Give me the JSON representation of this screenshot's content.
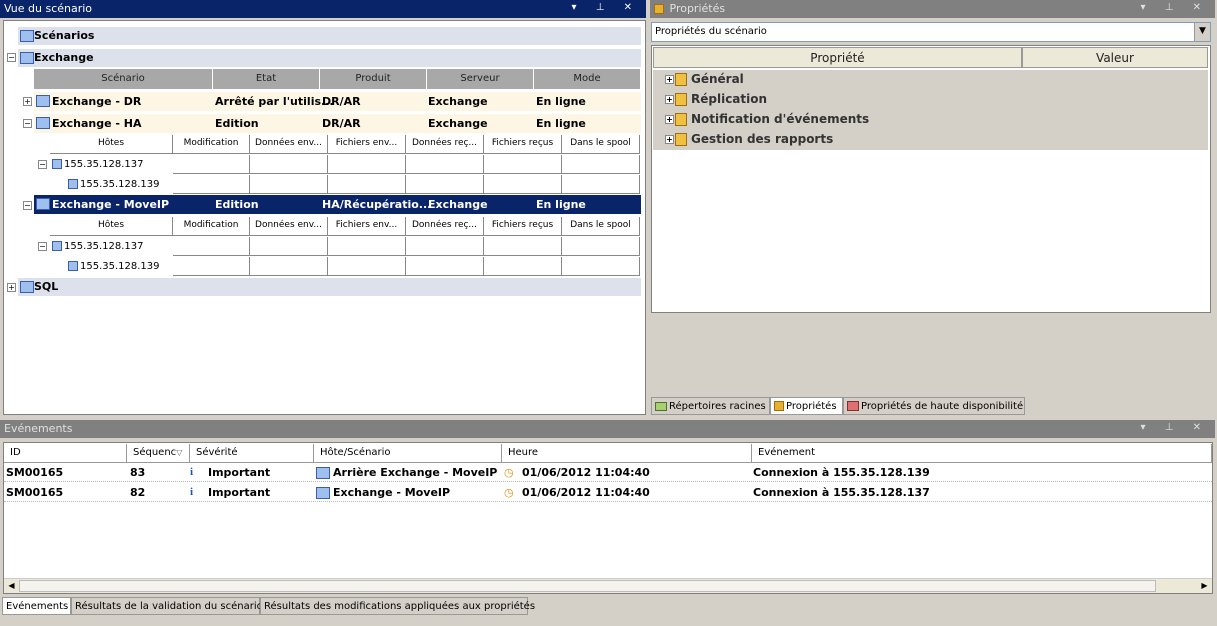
{
  "scenario_view": {
    "title": "Vue du scénario",
    "root": "Scénarios",
    "groups": [
      "Exchange",
      "SQL"
    ],
    "columns": [
      "Scénario",
      "Etat",
      "Produit",
      "Serveur",
      "Mode"
    ],
    "scenarios": [
      {
        "name": "Exchange - DR",
        "state": "Arrêté par l'utilis...",
        "product": "DR/AR",
        "server": "Exchange",
        "mode": "En ligne"
      },
      {
        "name": "Exchange - HA",
        "state": "Edition",
        "product": "DR/AR",
        "server": "Exchange",
        "mode": "En ligne"
      },
      {
        "name": "Exchange - MoveIP",
        "state": "Edition",
        "product": "HA/Récupératio...",
        "server": "Exchange",
        "mode": "En ligne"
      }
    ],
    "host_columns": [
      "Hôtes",
      "Modification",
      "Données env...",
      "Fichiers env...",
      "Données reç...",
      "Fichiers reçus",
      "Dans le spool"
    ],
    "hosts": [
      "155.35.128.137",
      "155.35.128.139"
    ]
  },
  "properties": {
    "title": "Propriétés",
    "dropdown": "Propriétés du scénario",
    "columns": [
      "Propriété",
      "Valeur"
    ],
    "items": [
      "Général",
      "Réplication",
      "Notification d'événements",
      "Gestion des rapports"
    ],
    "tabs": [
      "Répertoires racines",
      "Propriétés",
      "Propriétés de haute disponibilité"
    ]
  },
  "events": {
    "title": "Evénements",
    "columns": [
      "ID",
      "Séquenc",
      "Sévérité",
      "Hôte/Scénario",
      "Heure",
      "Evénement"
    ],
    "rows": [
      {
        "id": "SM00165",
        "seq": "83",
        "severity": "Important",
        "host": "Arrière Exchange - MoveIP",
        "time": "01/06/2012 11:04:40",
        "event": "Connexion à 155.35.128.139"
      },
      {
        "id": "SM00165",
        "seq": "82",
        "severity": "Important",
        "host": "Exchange - MoveIP",
        "time": "01/06/2012 11:04:40",
        "event": "Connexion à 155.35.128.137"
      }
    ],
    "tabs": [
      "Evénements",
      "Résultats de la validation du scénario",
      "Résultats des modifications appliquées aux propriétés"
    ]
  },
  "colors": {
    "active_title": "#0a246a",
    "inactive_title": "#808080",
    "selection": "#0a246a"
  }
}
